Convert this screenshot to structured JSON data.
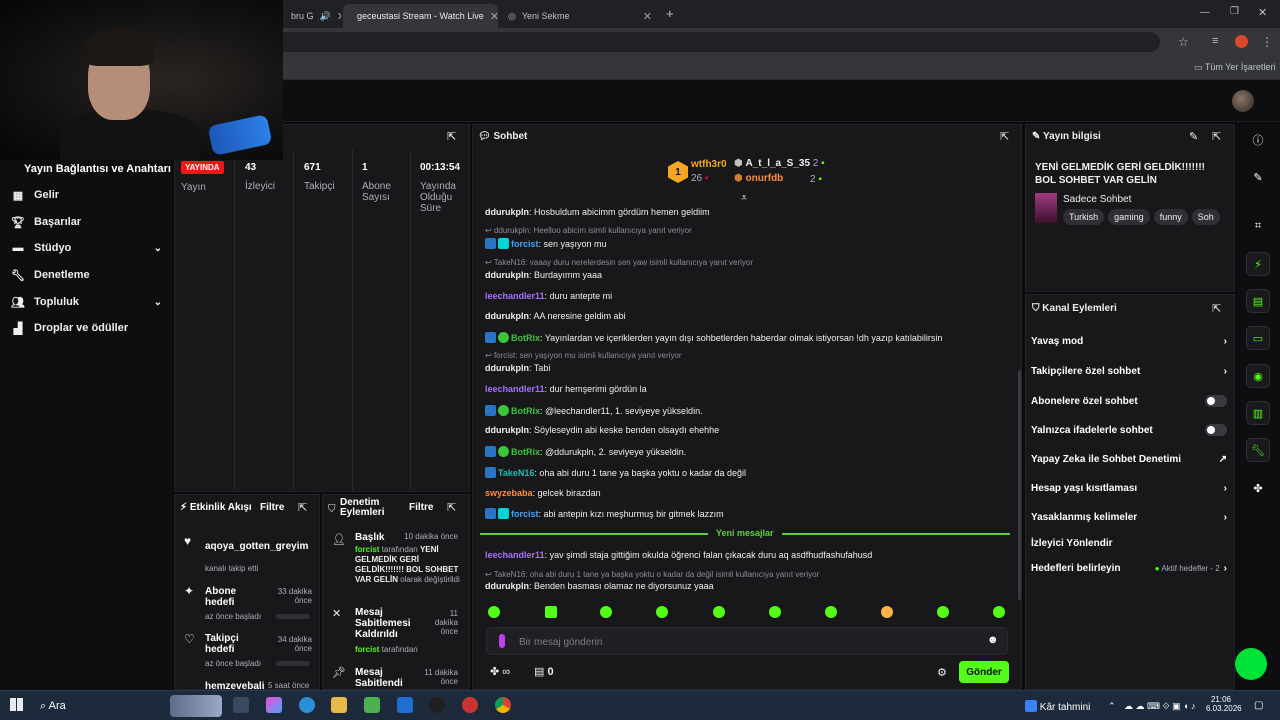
{
  "browser": {
    "tabs": [
      {
        "title": "bru G"
      },
      {
        "title": "geceustasi Stream - Watch Live"
      },
      {
        "title": "Yeni Sekme"
      }
    ],
    "bookmarks_label": "Tüm Yer İşaretleri"
  },
  "sidebar": {
    "title": "Yayın Bağlantısı ve Anahtarı",
    "items": [
      {
        "label": "Gelir",
        "icon": "table-icon"
      },
      {
        "label": "Başarılar",
        "icon": "trophy-icon"
      },
      {
        "label": "Stüdyo",
        "icon": "studio-icon"
      },
      {
        "label": "Denetleme",
        "icon": "wrench-icon"
      },
      {
        "label": "Topluluk",
        "icon": "people-icon"
      },
      {
        "label": "Droplar ve ödüller",
        "icon": "gift-icon"
      }
    ]
  },
  "stats": {
    "live": "YAYINDA",
    "stream_label": "Yayın",
    "viewers": "43",
    "viewers_label": "İzleyici",
    "followers": "671",
    "followers_label": "Takipçi",
    "subs": "1",
    "subs_label": "Abone Sayısı",
    "uptime": "00:13:54",
    "uptime_label": "Yayında Olduğu Süre"
  },
  "activity": {
    "title": "Etkinlik Akışı",
    "filter": "Filtre",
    "items": [
      {
        "title": "aqoya_gotten_greyim",
        "trailing": "d:",
        "sub": "kanalı takip etti"
      },
      {
        "title": "Abone hedefi",
        "time": "33 dakika önce",
        "sub": "az önce başladı"
      },
      {
        "title": "Takipçi hedefi",
        "time": "34 dakika önce",
        "sub": "az önce başladı"
      },
      {
        "title": "hemzevebali",
        "time": "5 saat önce"
      }
    ]
  },
  "modactions": {
    "title": "Denetim Eylemleri",
    "filter": "Filtre",
    "items": [
      {
        "title": "Başlık",
        "time": "10 dakika önce",
        "actor": "forcist",
        "pre": "tarafından",
        "value": "YENİ GELMEDİK GERİ GELDİK!!!!!!! BOL SOHBET VAR GELİN",
        "post": "olarak değiştirildi"
      },
      {
        "title": "Mesaj Sabitlemesi Kaldırıldı",
        "time": "11 dakika önce",
        "actor": "forcist",
        "pre": "tarafından"
      },
      {
        "title": "Mesaj Sabitlendi",
        "time": "11 dakika önce"
      }
    ]
  },
  "chat": {
    "title": "Sohbet",
    "top": {
      "rank": "1",
      "user1": "wtfh3r0",
      "count1": "26",
      "user2": "A_t_l_a_S_35",
      "count2": "2",
      "user3": "onurfdb",
      "count3": "2"
    },
    "messages": [
      {
        "user": "ddurukpln",
        "text": "Hosbuldum abicimm gördüm hemen geldiim"
      },
      {
        "reply": "ddurukpln: Heelloo abicim isimli kullanıcıya yanıt veriyor"
      },
      {
        "user": "forcist",
        "text": "sen yaşıyon mu"
      },
      {
        "reply": "TakeN16: vaaay duru nerelerdesin sen yaw isimli kullanıcıya yanıt veriyor"
      },
      {
        "user": "ddurukpln",
        "text": "Burdayımm yaaa"
      },
      {
        "user": "leechandler11",
        "text": "duru antepte mi"
      },
      {
        "user": "ddurukpln",
        "text": "AA neresine geldim abi"
      },
      {
        "user": "BotRix",
        "text": "Yayınlardan ve içeriklerden yayın dışı sohbetlerden haberdar olmak istiyorsan !dh yazıp katılabilirsin"
      },
      {
        "reply": "forcist: sen yaşıyon mu isimli kullanıcıya yanıt veriyor"
      },
      {
        "user": "ddurukpln",
        "text": "Tabi"
      },
      {
        "user": "leechandler11",
        "text": "dur hemşerimi gördün la"
      },
      {
        "user": "BotRix",
        "text": "@leechandler11, 1. seviyeye yükseldin."
      },
      {
        "user": "ddurukpln",
        "text": "Söyleseydin abi keske benden olsaydı ehehhe"
      },
      {
        "user": "BotRix",
        "text": "@ddurukpln, 2. seviyeye yükseldin."
      },
      {
        "user": "TakeN16",
        "text": "oha abi duru 1 tane ya başka yoktu o kadar da değil"
      },
      {
        "user": "swyzebaba",
        "text": "gelcek birazdan"
      },
      {
        "user": "forcist",
        "text": "abi antepin kızı meşhurmuş bir gitmek lazzım"
      },
      {
        "user": "leechandler11",
        "text": "yav şimdi staja gittiğim okulda öğrenci falan çıkacak duru aq asdfhudfashufahusd"
      },
      {
        "reply": "TakeN16: oha abi duru 1 tane ya başka yoktu o kadar da değil isimli kullanıcıya yanıt veriyor"
      },
      {
        "user": "ddurukpln",
        "text": "Benden basması olamaz ne diyorsunuz yaaa"
      }
    ],
    "new_messages": "Yeni mesajlar",
    "input_placeholder": "Bir mesaj gönderin",
    "points": "0",
    "send": "Gönder"
  },
  "streaminfo": {
    "title": "Yayın bilgisi",
    "stream_title": "YENİ GELMEDİK GERİ GELDİK!!!!!!! BOL SOHBET VAR GELİN",
    "category": "Sadece Sohbet",
    "tags": [
      "Turkish",
      "gaming",
      "funny",
      "Soh"
    ]
  },
  "channelactions": {
    "title": "Kanal Eylemleri",
    "rows": [
      {
        "label": "Yavaş mod"
      },
      {
        "label": "Takipçilere özel sohbet"
      },
      {
        "label": "Abonelere özel sohbet"
      },
      {
        "label": "Yalnızca ifadelerle sohbet"
      },
      {
        "label": "Yapay Zeka ile Sohbet Denetimi"
      },
      {
        "label": "Hesap yaşı kısıtlaması"
      },
      {
        "label": "Yasaklanmış kelimeler"
      },
      {
        "label": "İzleyici Yönlendir"
      },
      {
        "label": "Hedefleri belirleyin",
        "extra": "Aktif hedefler - 2"
      }
    ]
  },
  "taskbar": {
    "search": "Ara",
    "weather": "Kâr tahmini",
    "time": "21:06",
    "date": "6.03.2026"
  },
  "colors": {
    "accent": "#53fc18",
    "live": "#e91916",
    "panel": "#18181b"
  }
}
